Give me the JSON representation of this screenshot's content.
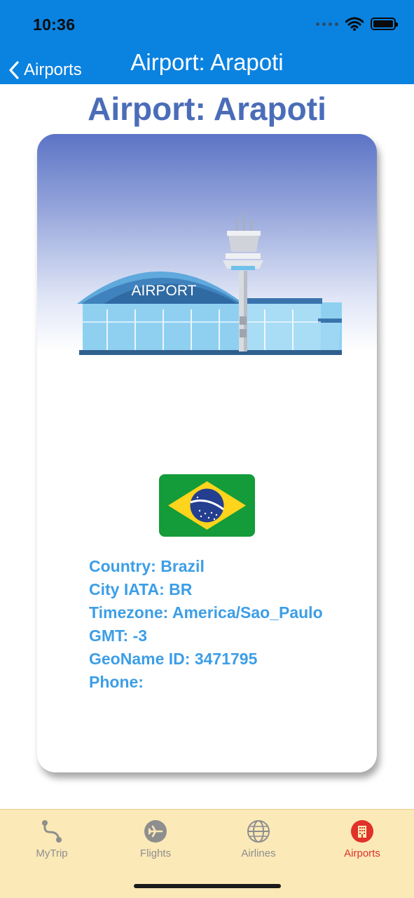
{
  "status_bar": {
    "time": "10:36"
  },
  "nav": {
    "back_label": "Airports",
    "title": "Airport: Arapoti"
  },
  "page": {
    "title": "Airport: Arapoti"
  },
  "card": {
    "illustration_label": "AIRPORT",
    "flag": "brazil-flag-icon",
    "info": {
      "country": "Country: Brazil",
      "city_iata": "City IATA: BR",
      "timezone": "Timezone: America/Sao_Paulo",
      "gmt": "GMT: -3",
      "geoname": "GeoName ID: 3471795",
      "phone": "Phone:"
    }
  },
  "tabs": [
    {
      "label": "MyTrip",
      "icon": "route-icon"
    },
    {
      "label": "Flights",
      "icon": "plane-icon"
    },
    {
      "label": "Airlines",
      "icon": "globe-icon"
    },
    {
      "label": "Airports",
      "icon": "building-icon",
      "active": true
    }
  ],
  "colors": {
    "header": "#0a82e0",
    "title": "#4b6db8",
    "info_text": "#3d9ee6",
    "tabbar": "#fbe9b7",
    "active_tab": "#e0312a",
    "inactive_tab": "#8e8e8e"
  }
}
